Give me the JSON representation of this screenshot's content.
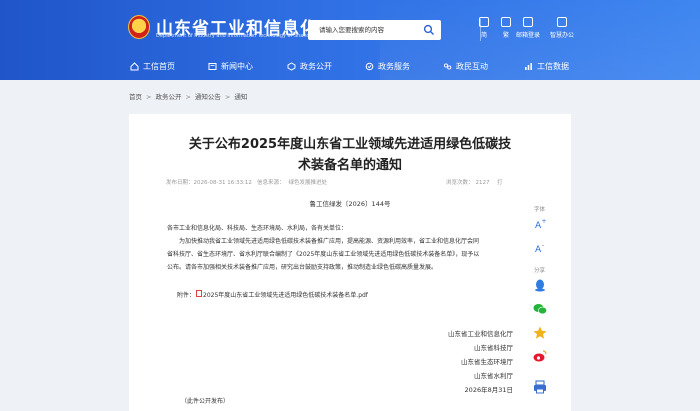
{
  "header": {
    "site_title": "山东省工业和信息化厅",
    "site_subtitle": "Department of Industry and Information Technology of Shandong Province",
    "search_placeholder": "请输入您要搜索的内容",
    "top_links": [
      {
        "label": "简",
        "icon": "simplified-chinese-icon"
      },
      {
        "label": "繁",
        "icon": "traditional-chinese-icon"
      },
      {
        "label": "邮箱登录",
        "icon": "mail-icon"
      },
      {
        "label": "智慧办公",
        "icon": "office-icon"
      }
    ]
  },
  "nav": [
    {
      "label": "工信首页",
      "icon": "home-icon"
    },
    {
      "label": "新闻中心",
      "icon": "news-icon"
    },
    {
      "label": "政务公开",
      "icon": "open-government-icon"
    },
    {
      "label": "政务服务",
      "icon": "service-icon"
    },
    {
      "label": "政民互动",
      "icon": "interaction-icon"
    },
    {
      "label": "工信数据",
      "icon": "data-icon"
    }
  ],
  "breadcrumb": [
    "首页",
    "政务公开",
    "通知公告",
    "通知"
  ],
  "article": {
    "title_line1": "关于公布2025年度山东省工业领域先进适用绿色低碳技",
    "title_line2": "术装备名单的通知",
    "publish_label": "发布日期：2026-08-31 16:33:12",
    "source_label": "信息来源：",
    "source": "绿色发展推进处",
    "views_label": "浏览次数：",
    "views": "2127",
    "print_label": "打",
    "doc_number": "鲁工信绿发〔2026〕144号",
    "addressee": "各市工业和信息化局、科技局、生态环境局、水利局，各有关单位：",
    "paragraph_line1": "为加快推动我省工业领域先进适用绿色低碳技术装备推广应用，提高能源、资源利用效率，省工业和信息化厅会同",
    "paragraph_line2": "省科技厅、省生态环境厅、省水利厅联合编制了《2025年度山东省工业领域先进适用绿色低碳技术装备名单》，现予以",
    "paragraph_line3": "公布。请各市加强相关技术装备推广应用，研究出台鼓励支持政策，推动制造业绿色低碳高质量发展。",
    "attachment_label": "附件：",
    "attachment_file": "2025年度山东省工业领域先进适用绿色低碳技术装备名单.pdf",
    "signatures": [
      "山东省工业和信息化厅",
      "山东省科技厅",
      "山东省生态环境厅",
      "山东省水利厅",
      "2026年8月31日"
    ],
    "publish_note": "（此件公开发布）"
  },
  "side_tools": {
    "font_label": "字体",
    "share_label": "分享",
    "buttons": [
      {
        "name": "font-increase-icon",
        "glyph": "A+"
      },
      {
        "name": "font-decrease-icon",
        "glyph": "A-"
      },
      {
        "name": "qq-share-icon",
        "glyph": ""
      },
      {
        "name": "wechat-share-icon",
        "glyph": ""
      },
      {
        "name": "favorite-share-icon",
        "glyph": ""
      },
      {
        "name": "weibo-share-icon",
        "glyph": ""
      },
      {
        "name": "print-icon",
        "glyph": ""
      }
    ]
  },
  "colors": {
    "header_start": "#1f55c8",
    "header_end": "#3f86f0",
    "page_background": "#eef1f6"
  }
}
